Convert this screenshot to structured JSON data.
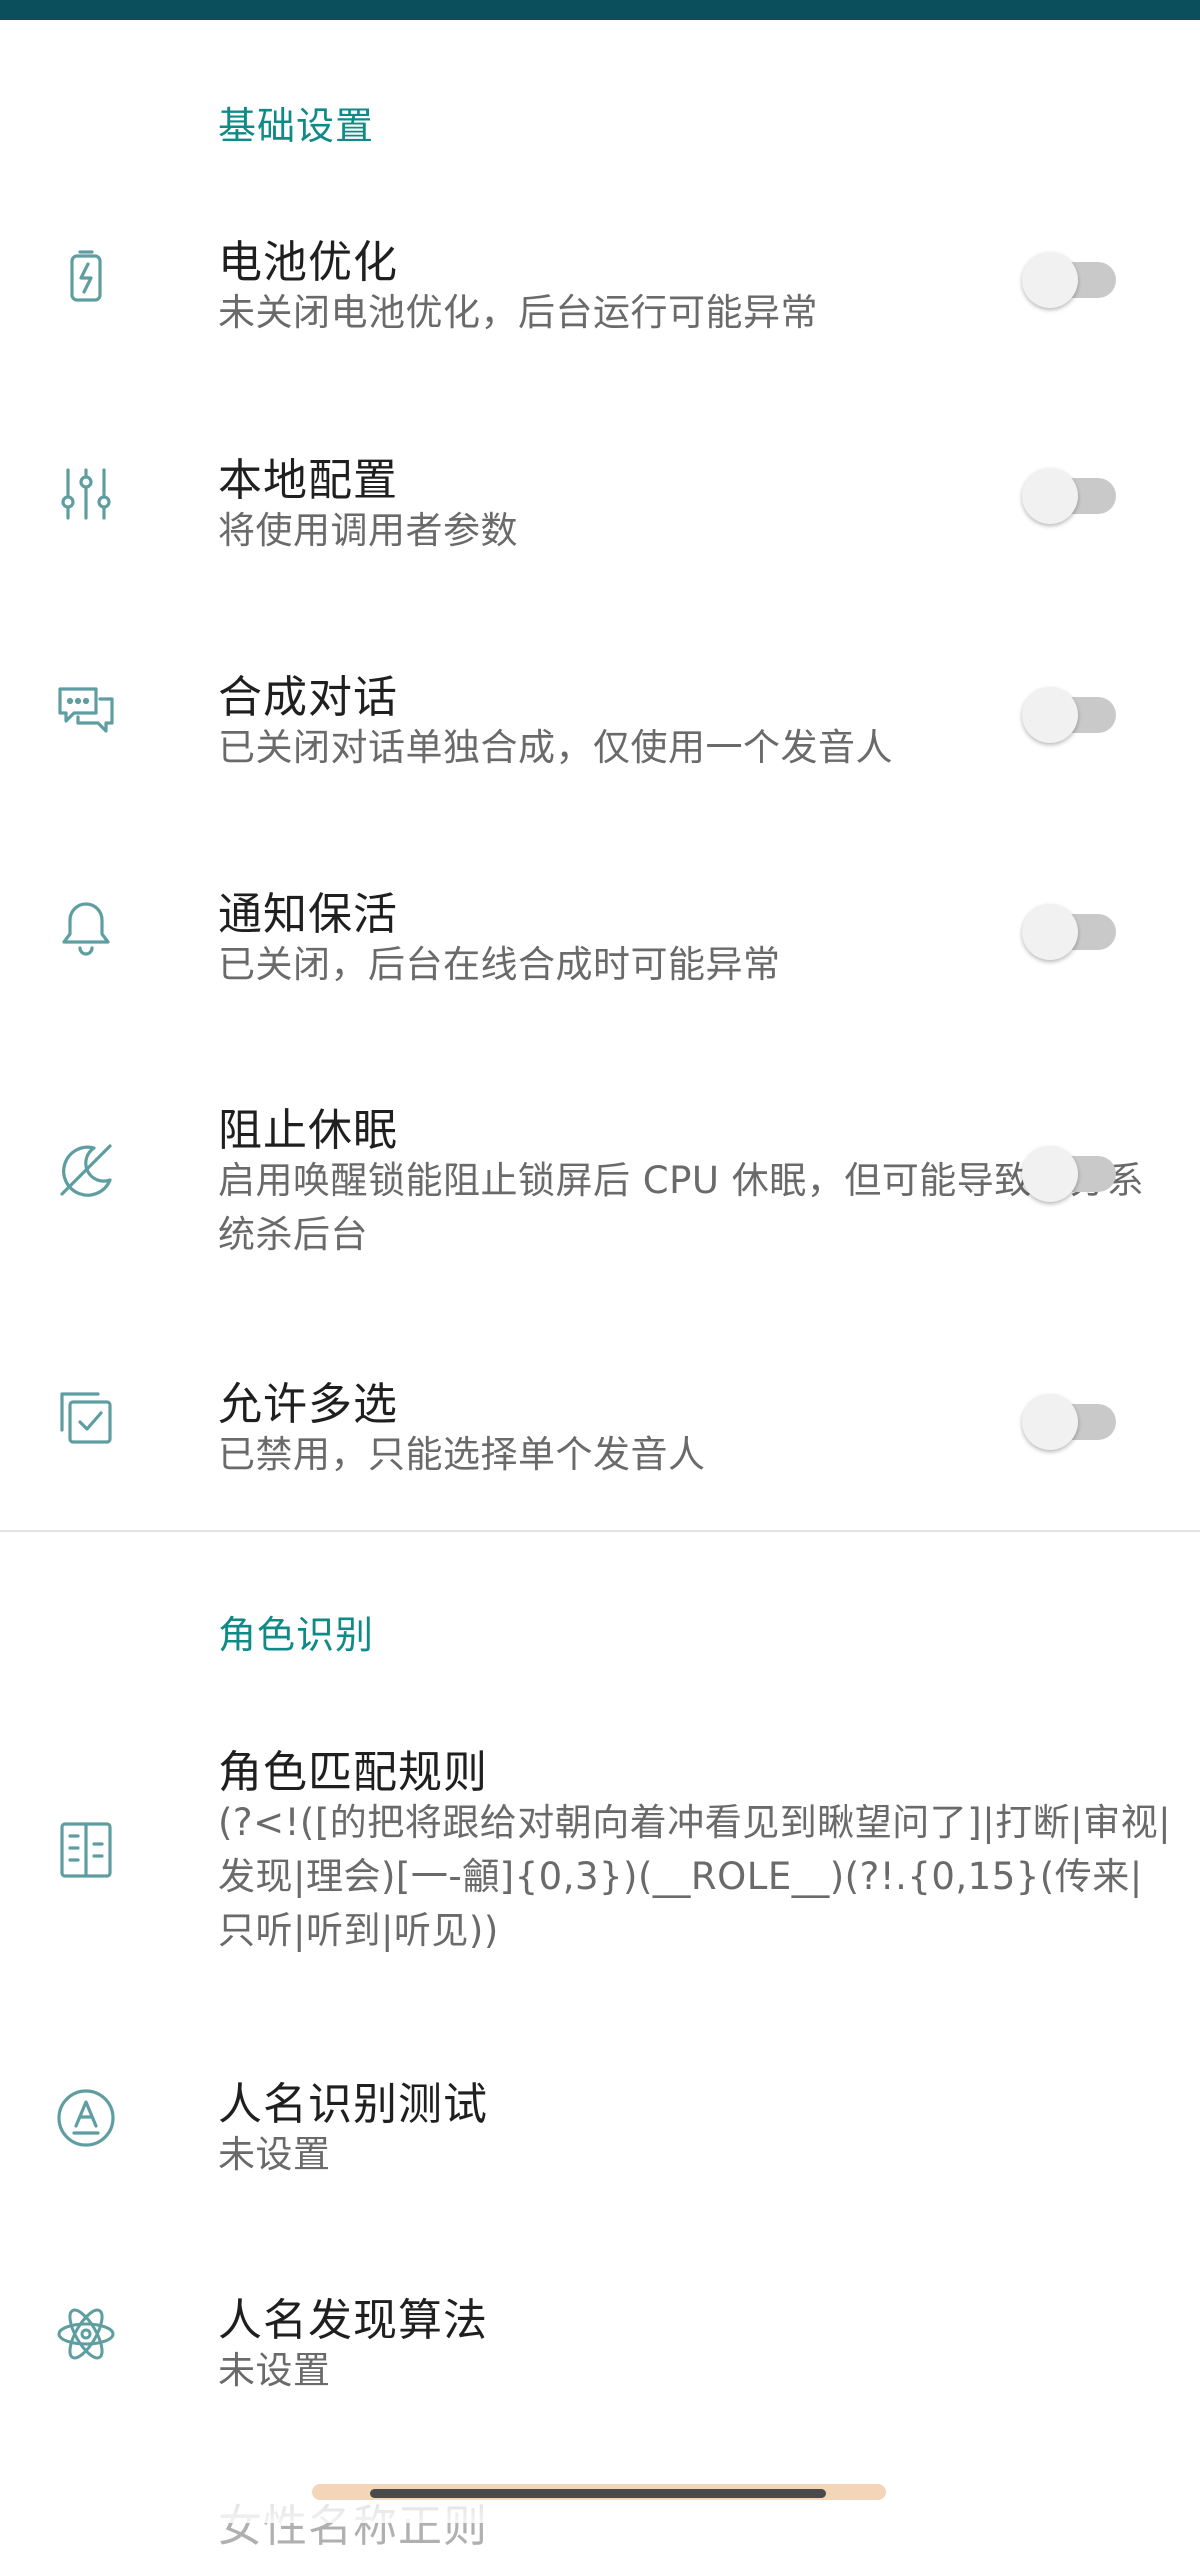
{
  "sections": [
    {
      "header": "基础设置",
      "items": [
        {
          "title": "电池优化",
          "summary": "未关闭电池优化，后台运行可能异常",
          "icon": "battery-charging-icon",
          "switch": false
        },
        {
          "title": "本地配置",
          "summary": "将使用调用者参数",
          "icon": "sliders-icon",
          "switch": false
        },
        {
          "title": "合成对话",
          "summary": "已关闭对话单独合成，仅使用一个发音人",
          "icon": "chat-bubbles-icon",
          "switch": false
        },
        {
          "title": "通知保活",
          "summary": "已关闭，后台在线合成时可能异常",
          "icon": "bell-icon",
          "switch": false
        },
        {
          "title": "阻止休眠",
          "summary": "启用唤醒锁能阻止锁屏后 CPU 休眠，但可能导致部分系统杀后台",
          "icon": "sleep-off-icon",
          "switch": false
        },
        {
          "title": "允许多选",
          "summary": "已禁用，只能选择单个发音人",
          "icon": "multi-select-icon",
          "switch": false
        }
      ]
    },
    {
      "header": "角色识别",
      "items": [
        {
          "title": "角色匹配规则",
          "summary": "(?<!([的把将跟给对朝向着冲看见到瞅望问了]|打断|审视|发现|理会)[一-龥]{0,3})(__ROLE__)(?!.{0,15}(传来|只听|听到|听见))",
          "icon": "rules-list-icon"
        },
        {
          "title": "人名识别测试",
          "summary": "未设置",
          "icon": "name-test-icon"
        },
        {
          "title": "人名发现算法",
          "summary": "未设置",
          "icon": "atom-icon"
        }
      ]
    }
  ],
  "partial_next_item": "女性名称正则",
  "colors": {
    "accent": "#0f8a86",
    "icon": "#5f9ea0",
    "statusbar": "#0b4f5c"
  }
}
